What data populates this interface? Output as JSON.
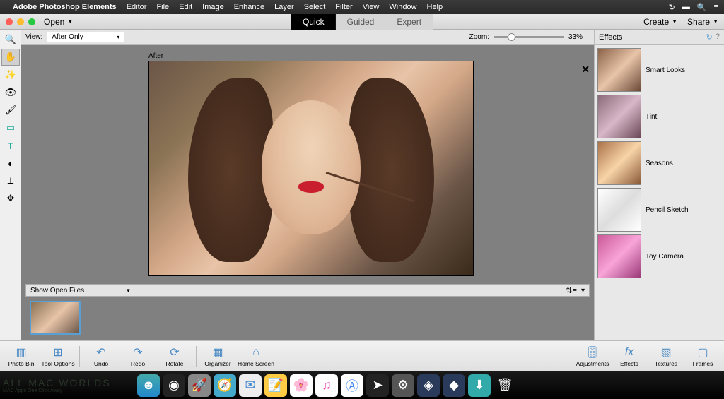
{
  "menubar": {
    "app_name": "Adobe Photoshop Elements",
    "items": [
      "Editor",
      "File",
      "Edit",
      "Image",
      "Enhance",
      "Layer",
      "Select",
      "Filter",
      "View",
      "Window",
      "Help"
    ]
  },
  "titlebar": {
    "open_label": "Open",
    "tabs": [
      {
        "label": "Quick",
        "active": true
      },
      {
        "label": "Guided",
        "active": false
      },
      {
        "label": "Expert",
        "active": false
      }
    ],
    "create_label": "Create",
    "share_label": "Share"
  },
  "viewbar": {
    "view_label": "View:",
    "view_value": "After Only",
    "zoom_label": "Zoom:",
    "zoom_value": "33%"
  },
  "canvas": {
    "label": "After"
  },
  "open_files": {
    "label": "Show Open Files"
  },
  "effects_panel": {
    "title": "Effects",
    "items": [
      {
        "label": "Smart Looks",
        "style": "smart"
      },
      {
        "label": "Tint",
        "style": "tint"
      },
      {
        "label": "Seasons",
        "style": "seasons"
      },
      {
        "label": "Pencil Sketch",
        "style": "sketch"
      },
      {
        "label": "Toy Camera",
        "style": "toy"
      }
    ]
  },
  "tools": [
    {
      "name": "zoom-tool",
      "glyph": "🔍",
      "active": false
    },
    {
      "name": "hand-tool",
      "glyph": "✋",
      "active": true
    },
    {
      "name": "quick-select-tool",
      "glyph": "✨",
      "active": false
    },
    {
      "name": "redeye-tool",
      "glyph": "👁",
      "active": false
    },
    {
      "name": "whiten-teeth-tool",
      "glyph": "🖌",
      "active": false
    },
    {
      "name": "straighten-tool",
      "glyph": "▭",
      "active": false
    },
    {
      "name": "type-tool",
      "glyph": "T",
      "active": false
    },
    {
      "name": "spot-heal-tool",
      "glyph": "◐",
      "active": false
    },
    {
      "name": "crop-tool",
      "glyph": "✂",
      "active": false
    },
    {
      "name": "move-tool",
      "glyph": "✥",
      "active": false
    }
  ],
  "bottom": {
    "photo_bin": "Photo Bin",
    "tool_options": "Tool Options",
    "undo": "Undo",
    "redo": "Redo",
    "rotate": "Rotate",
    "organizer": "Organizer",
    "home_screen": "Home Screen",
    "adjustments": "Adjustments",
    "effects": "Effects",
    "textures": "Textures",
    "frames": "Frames"
  },
  "watermark": {
    "line1": "ALL MAC WORLDS",
    "line2": "MAC Apps One Click Away"
  }
}
